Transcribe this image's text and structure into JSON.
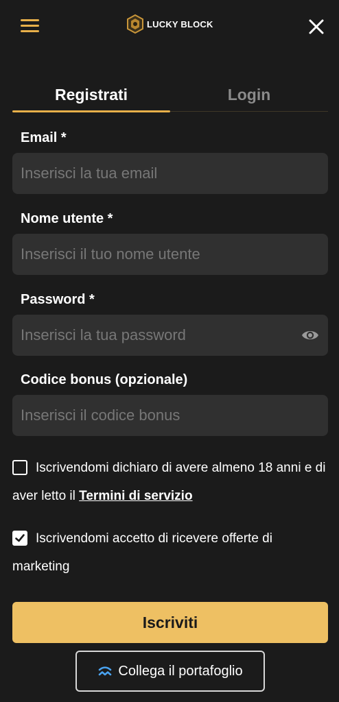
{
  "header": {
    "logo_text": "LUCKY BLOCK",
    "accent_color": "#e8b04a"
  },
  "tabs": [
    {
      "label": "Registrati",
      "active": true
    },
    {
      "label": "Login",
      "active": false
    }
  ],
  "form": {
    "email": {
      "label": "Email *",
      "placeholder": "Inserisci la tua email",
      "value": ""
    },
    "username": {
      "label": "Nome utente *",
      "placeholder": "Inserisci il tuo nome utente",
      "value": ""
    },
    "password": {
      "label": "Password *",
      "placeholder": "Inserisci la tua password",
      "value": "",
      "icon": "eye-icon"
    },
    "bonus": {
      "label": "Codice bonus (opzionale)",
      "placeholder": "Inserisci il codice bonus",
      "value": ""
    }
  },
  "consents": {
    "age": {
      "checked": false,
      "text": "Iscrivendomi dichiaro di avere almeno 18 anni e di aver letto il",
      "link": "Termini di servizio"
    },
    "marketing": {
      "checked": true,
      "text": "Iscrivendomi accetto di ricevere offerte di marketing"
    }
  },
  "actions": {
    "submit_label": "Iscriviti",
    "submit_color": "#eec063",
    "wallet_label": "Collega il portafoglio",
    "wallet_icon": "wallet-connect-icon"
  }
}
